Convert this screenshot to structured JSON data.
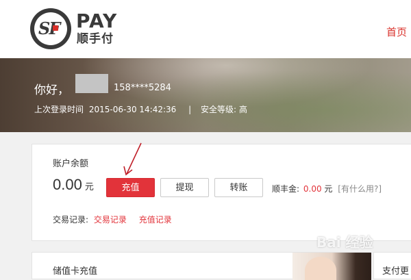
{
  "brand": {
    "logo_mark": "SF",
    "logo_word": "PAY",
    "logo_cn": "顺手付"
  },
  "nav": {
    "home": "首页"
  },
  "banner": {
    "greeting": "你好，",
    "phone": "158****5284",
    "last_login_label": "上次登录时间",
    "last_login_time": "2015-06-30 14:42:36",
    "separator": "|",
    "security_label": "安全等级:",
    "security_level": "高"
  },
  "account": {
    "title": "账户余额",
    "balance": "0.00",
    "unit": "元",
    "buttons": {
      "charge": "充值",
      "withdraw": "提现",
      "transfer": "转账"
    },
    "fund_label": "顺丰金:",
    "fund_value": "0.00",
    "fund_unit": "元",
    "fund_help": "[有什么用?]",
    "records_label": "交易记录:",
    "records_link1": "交易记录",
    "records_link2": "充值记录"
  },
  "bottom": {
    "stored_card": "储值卡充值",
    "pay_tab": "支付更"
  },
  "watermark": "Bai 经验",
  "colors": {
    "accent": "#e2333a",
    "logo_dark": "#3a3a3a",
    "annotation": "#c0202a"
  }
}
